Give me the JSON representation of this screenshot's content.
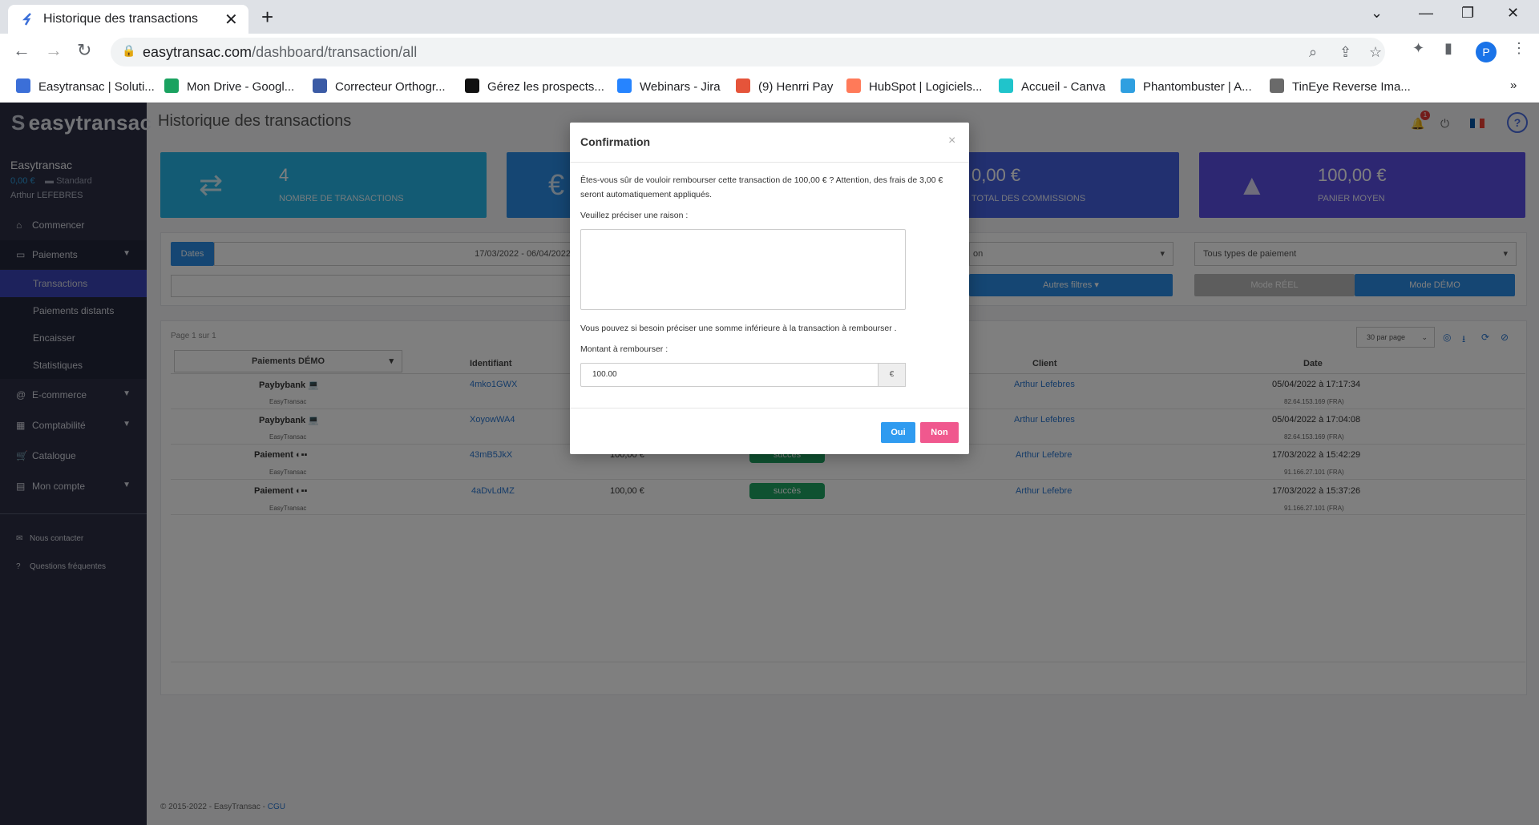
{
  "browser": {
    "tab_title": "Historique des transactions",
    "url_domain": "easytransac.com",
    "url_path": "/dashboard/transaction/all",
    "profile_initial": "P",
    "bookmarks": [
      {
        "label": "Easytransac | Soluti...",
        "color": "#3b6fd8"
      },
      {
        "label": "Mon Drive - Googl...",
        "color": "#1aa260"
      },
      {
        "label": "Correcteur Orthogr...",
        "color": "#3b5ba5"
      },
      {
        "label": "Gérez les prospects...",
        "color": "#111111"
      },
      {
        "label": "Webinars - Jira",
        "color": "#2684ff"
      },
      {
        "label": "(9) Henrri Pay",
        "color": "#e5543a"
      },
      {
        "label": "HubSpot | Logiciels...",
        "color": "#ff7a59"
      },
      {
        "label": "Accueil - Canva",
        "color": "#20c4cb"
      },
      {
        "label": "Phantombuster | A...",
        "color": "#2f9fe0"
      },
      {
        "label": "TinEye Reverse Ima...",
        "color": "#6a6a6a"
      }
    ]
  },
  "sidebar": {
    "logo": "easytransac",
    "account_name": "Easytransac",
    "balance": "0,00 €",
    "plan": "Standard",
    "user": "Arthur LEFEBRES",
    "items": [
      {
        "label": "Commencer"
      },
      {
        "label": "Paiements"
      },
      {
        "label": "Transactions"
      },
      {
        "label": "Paiements distants"
      },
      {
        "label": "Encaisser"
      },
      {
        "label": "Statistiques"
      },
      {
        "label": "E-commerce"
      },
      {
        "label": "Comptabilité"
      },
      {
        "label": "Catalogue"
      },
      {
        "label": "Mon compte"
      }
    ],
    "contact": "Nous contacter",
    "faq": "Questions fréquentes"
  },
  "header": {
    "title": "Historique des transactions",
    "notification_count": "1"
  },
  "stats": [
    {
      "value": "4",
      "label": "NOMBRE DE TRANSACTIONS",
      "color": "#27b7e8"
    },
    {
      "value": "",
      "label": "",
      "color": "#2b8de6"
    },
    {
      "value": "0,00 €",
      "label": "TOTAL DES COMMISSIONS",
      "color": "#4561e0"
    },
    {
      "value": "100,00 €",
      "label": "PANIER MOYEN",
      "color": "#5a4ee4"
    }
  ],
  "filters": {
    "dates_label": "Dates",
    "date_range": "17/03/2022 - 06/04/2022",
    "status_select": "on",
    "payment_type_select": "Tous types de paiement",
    "other_filters": "Autres filtres",
    "mode_real": "Mode RÉEL",
    "mode_demo": "Mode DÉMO"
  },
  "table": {
    "page_info": "Page 1 sur 1",
    "per_page": "30 par page",
    "mode_select": "Paiements DÉMO",
    "headers": {
      "id": "Identifiant",
      "client": "Client",
      "date": "Date"
    },
    "rows": [
      {
        "type": "Paybybank",
        "sub": "EasyTransac",
        "id": "4mko1GWX",
        "amount": "",
        "status": "",
        "client": "Arthur Lefebres",
        "date": "05/04/2022 à 17:17:34",
        "ip": "82.64.153.169 (FRA)"
      },
      {
        "type": "Paybybank",
        "sub": "EasyTransac",
        "id": "XoyowWA4",
        "amount": "",
        "status": "",
        "client": "Arthur Lefebres",
        "date": "05/04/2022 à 17:04:08",
        "ip": "82.64.153.169 (FRA)"
      },
      {
        "type": "Paiement",
        "sub": "EasyTransac",
        "id": "43mB5JkX",
        "amount": "100,00 €",
        "status": "succès",
        "client": "Arthur Lefebre",
        "date": "17/03/2022 à 15:42:29",
        "ip": "91.166.27.101 (FRA)"
      },
      {
        "type": "Paiement",
        "sub": "EasyTransac",
        "id": "4aDvLdMZ",
        "amount": "100,00 €",
        "status": "succès",
        "client": "Arthur Lefebre",
        "date": "17/03/2022 à 15:37:26",
        "ip": "91.166.27.101 (FRA)"
      }
    ]
  },
  "footer": {
    "copyright": "© 2015-2022 - EasyTransac - ",
    "cgu": "CGU"
  },
  "modal": {
    "title": "Confirmation",
    "line1": "Êtes-vous sûr de vouloir rembourser cette transaction de 100,00 € ? Attention, des frais de 3,00 €",
    "line2": "seront automatiquement appliqués.",
    "reason_label": "Veuillez préciser une raison :",
    "reason_value": "",
    "hint": "Vous pouvez si besoin préciser une somme inférieure à la transaction à rembourser .",
    "amount_label": "Montant à rembourser :",
    "amount_value": "100.00",
    "currency": "€",
    "yes": "Oui",
    "no": "Non"
  }
}
